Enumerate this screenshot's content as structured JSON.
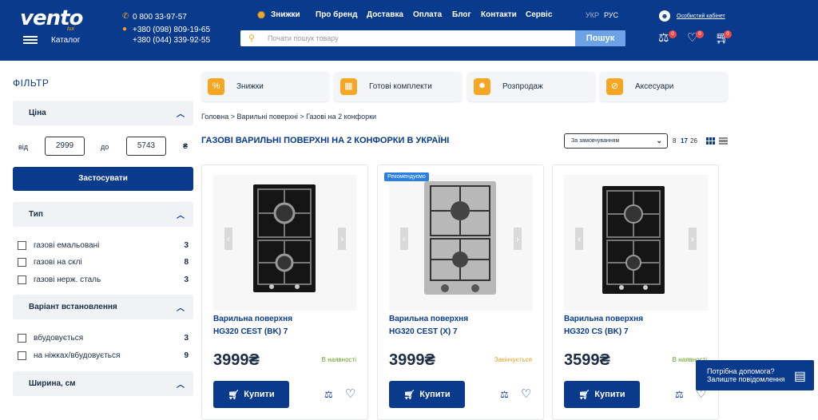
{
  "header": {
    "logo": "vento",
    "logo_sub": "lux",
    "catalog": "Каталог",
    "phones": [
      "0 800 33-97-57",
      "+380 (098) 809-19-65",
      "+380 (044) 339-92-55"
    ],
    "nav": [
      "Знижки",
      "Про бренд",
      "Доставка",
      "Оплата",
      "Блог",
      "Контакти",
      "Сервіс"
    ],
    "lang_ukr": "УКР",
    "lang_rus": "РУС",
    "account": "Особистий кабінет",
    "search_placeholder": "Почати пошук товару",
    "search_button": "Пошук",
    "badge_compare": "0",
    "badge_wishlist": "0",
    "badge_cart": "0"
  },
  "sidebar": {
    "title": "ФІЛЬТР",
    "price_title": "Ціна",
    "from_label": "від",
    "to_label": "до",
    "price_min": "2999",
    "price_max": "5743",
    "currency": "₴",
    "apply": "Застосувати",
    "type_title": "Тип",
    "type_items": [
      {
        "label": "газові емальовані",
        "count": "3"
      },
      {
        "label": "газові на склі",
        "count": "8"
      },
      {
        "label": "газові нерж. сталь",
        "count": "3"
      }
    ],
    "install_title": "Варіант встановлення",
    "install_items": [
      {
        "label": "вбудовується",
        "count": "3"
      },
      {
        "label": "на ніжках/вбудовується",
        "count": "9"
      }
    ],
    "width_title": "Ширина, см"
  },
  "categories": [
    "Знижки",
    "Готові комплекти",
    "Розпродаж",
    "Аксесуари"
  ],
  "breadcrumb": "Головна > Варильні поверхні > Газові на 2 конфорки",
  "page_title": "ГАЗОВІ ВАРИЛЬНІ ПОВЕРХНІ НА 2 КОНФОРКИ В УКРАЇНІ",
  "sort": "За замовчуванням",
  "per_page": [
    "8",
    "17",
    "26"
  ],
  "products": [
    {
      "name_line1": "Варильна поверхня",
      "name_line2": "HG320 CEST (BK) 7",
      "price": "3999₴",
      "stock": "В наявності",
      "stock_color": "#6a9e2a",
      "buy": "Купити",
      "badge": ""
    },
    {
      "name_line1": "Варильна поверхня",
      "name_line2": "HG320 CEST (X) 7",
      "price": "3999₴",
      "stock": "Закінчується",
      "stock_color": "#e0a32a",
      "buy": "Купити",
      "badge": "Рекомендуємо"
    },
    {
      "name_line1": "Варильна поверхня",
      "name_line2": "HG320 CS (BK) 7",
      "price": "3599₴",
      "stock": "В наявності",
      "stock_color": "#6a9e2a",
      "buy": "Купити",
      "badge": ""
    }
  ],
  "help": {
    "line1": "Потрібна допомога?",
    "line2": "Залиште повідомлення"
  }
}
